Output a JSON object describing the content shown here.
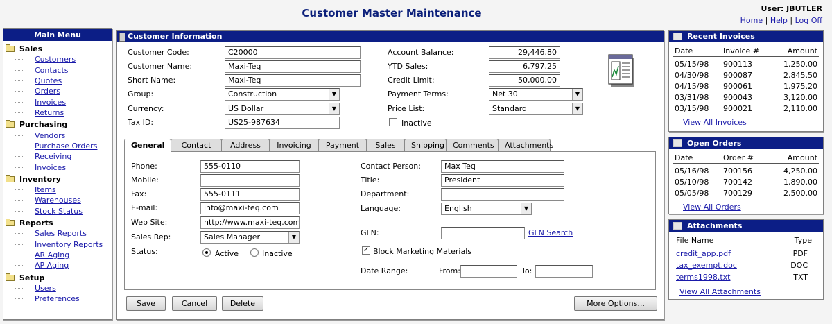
{
  "header": {
    "title": "Customer Master Maintenance",
    "user": "User: JBUTLER",
    "links": [
      "Home",
      "Help",
      "Log Off"
    ]
  },
  "menu": {
    "title": "Main Menu",
    "groups": [
      {
        "label": "Sales",
        "items": [
          "Customers",
          "Contacts",
          "Quotes",
          "Orders",
          "Invoices",
          "Returns"
        ]
      },
      {
        "label": "Purchasing",
        "items": [
          "Vendors",
          "Purchase Orders",
          "Receiving",
          "Invoices"
        ]
      },
      {
        "label": "Inventory",
        "items": [
          "Items",
          "Warehouses",
          "Stock Status"
        ]
      },
      {
        "label": "Reports",
        "items": [
          "Sales Reports",
          "Inventory Reports",
          "AR Aging",
          "AP Aging"
        ]
      },
      {
        "label": "Setup",
        "items": [
          "Users",
          "Preferences"
        ]
      }
    ]
  },
  "customer": {
    "panel_title": "Customer Information",
    "code_label": "Customer Code:",
    "code": "C20000",
    "name_label": "Customer Name:",
    "name": "Maxi-Teq",
    "short_label": "Short Name:",
    "short": "Maxi-Teq",
    "group_label": "Group:",
    "group": "Construction",
    "currency_label": "Currency:",
    "currency": "US Dollar",
    "tax_label": "Tax ID:",
    "tax": "US25-987634",
    "balance_label": "Account Balance:",
    "balance": "29,446.80",
    "ytd_label": "YTD Sales:",
    "ytd": "6,797.25",
    "credit_label": "Credit Limit:",
    "credit": "50,000.00",
    "terms_label": "Payment Terms:",
    "terms": "Net 30",
    "price_label": "Price List:",
    "price": "Standard",
    "inactive_label": "Inactive"
  },
  "tabs": [
    "General",
    "Contact",
    "Address",
    "Invoicing",
    "Payment",
    "Sales",
    "Shipping",
    "Comments",
    "Attachments"
  ],
  "general": {
    "phone_label": "Phone:",
    "phone": "555-0110",
    "mobile_label": "Mobile:",
    "mobile": "",
    "fax_label": "Fax:",
    "fax": "555-0111",
    "email_label": "E-mail:",
    "email": "info@maxi-teq.com",
    "web_label": "Web Site:",
    "web": "http://www.maxi-teq.com",
    "rep_label": "Sales Rep:",
    "rep": "Sales Manager",
    "status_label": "Status:",
    "active_label": "Active",
    "inactive_label": "Inactive",
    "contact_label": "Contact Person:",
    "contact": "Max Teq",
    "title_label": "Title:",
    "title": "President",
    "dept_label": "Department:",
    "dept": "",
    "lang_label": "Language:",
    "lang": "English",
    "gln_label": "GLN:",
    "gln": "",
    "gln_link": "GLN Search",
    "block_label": "Block Marketing Materials",
    "range_label": "Date Range:",
    "from_label": "From:",
    "to_label": "To:"
  },
  "buttons": {
    "save": "Save",
    "cancel": "Cancel",
    "delete": "Delete",
    "more": "More Options..."
  },
  "recent_invoices": {
    "title": "Recent Invoices",
    "cols": [
      "Date",
      "Invoice #",
      "Amount"
    ],
    "rows": [
      [
        "05/15/98",
        "900113",
        "1,250.00"
      ],
      [
        "04/30/98",
        "900087",
        "2,845.50"
      ],
      [
        "04/15/98",
        "900061",
        "1,975.20"
      ],
      [
        "03/31/98",
        "900043",
        "3,120.00"
      ],
      [
        "03/15/98",
        "900021",
        "2,110.00"
      ]
    ],
    "link": "View All Invoices"
  },
  "open_orders": {
    "title": "Open Orders",
    "cols": [
      "Date",
      "Order #",
      "Amount"
    ],
    "rows": [
      [
        "05/16/98",
        "700156",
        "4,250.00"
      ],
      [
        "05/10/98",
        "700142",
        "1,890.00"
      ],
      [
        "05/05/98",
        "700129",
        "2,500.00"
      ]
    ],
    "link": "View All Orders"
  },
  "attachments": {
    "title": "Attachments",
    "cols": [
      "File Name",
      "Type"
    ],
    "rows": [
      [
        "credit_app.pdf",
        "PDF"
      ],
      [
        "tax_exempt.doc",
        "DOC"
      ],
      [
        "terms1998.txt",
        "TXT"
      ]
    ],
    "link": "View All Attachments"
  }
}
